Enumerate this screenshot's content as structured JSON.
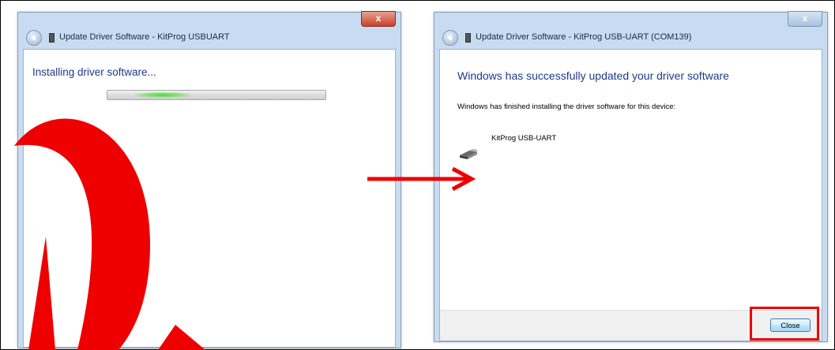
{
  "left_window": {
    "title": "Update Driver Software - KitProg USBUART",
    "close_glyph": "x",
    "status_text": "Installing driver software...",
    "progress_state": "indeterminate"
  },
  "right_window": {
    "title": "Update Driver Software - KitProg USB-UART (COM139)",
    "close_glyph": "x",
    "heading": "Windows has successfully updated your driver software",
    "description": "Windows has finished installing the driver software for this device:",
    "device_name": "KitProg USB-UART",
    "close_button_label": "Close"
  },
  "annotations": {
    "arrow_color": "#ee0000",
    "highlight_color": "#ee0000",
    "watermark_color": "#ee0000"
  }
}
